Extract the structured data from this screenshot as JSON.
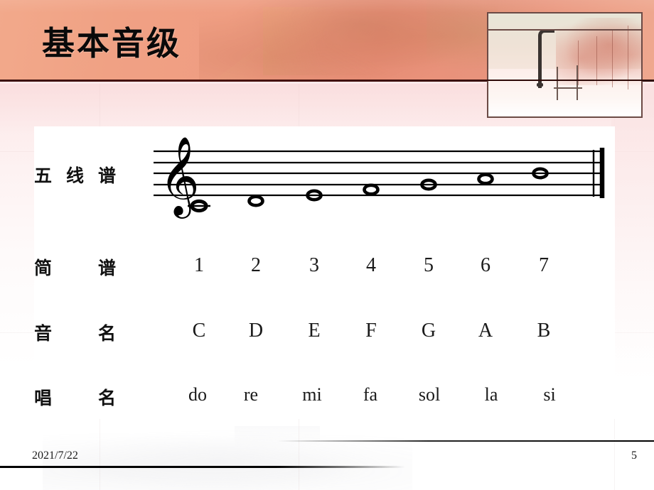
{
  "slide": {
    "title": "基本音级",
    "page_number": "5",
    "date": "2021/7/22"
  },
  "theme": {
    "header_start": "#f2a98b",
    "header_end": "#e8937c",
    "header_rule": "#3b0f0c",
    "panel_bg": "#ffffff",
    "text": "#111111",
    "frame_border": "#6b4a45"
  },
  "table": {
    "rows": [
      {
        "label": "五线谱",
        "name": "staff-notation",
        "kind": "staff"
      },
      {
        "label": "简　谱",
        "name": "numbered-notation",
        "kind": "text",
        "cells": [
          "1",
          "2",
          "3",
          "4",
          "5",
          "6",
          "7"
        ]
      },
      {
        "label": "音　名",
        "name": "pitch-names",
        "kind": "text",
        "cells": [
          "C",
          "D",
          "E",
          "F",
          "G",
          "A",
          "B"
        ]
      },
      {
        "label": "唱　名",
        "name": "solfege-names",
        "kind": "text",
        "cells": [
          "do",
          "re",
          "mi",
          "fa",
          "sol",
          "la",
          "si"
        ]
      }
    ]
  },
  "chart_data": {
    "type": "table",
    "title": "基本音级",
    "categories": [
      "1",
      "2",
      "3",
      "4",
      "5",
      "6",
      "7"
    ],
    "series": [
      {
        "name": "简谱",
        "values": [
          "1",
          "2",
          "3",
          "4",
          "5",
          "6",
          "7"
        ]
      },
      {
        "name": "音名",
        "values": [
          "C",
          "D",
          "E",
          "F",
          "G",
          "A",
          "B"
        ]
      },
      {
        "name": "唱名",
        "values": [
          "do",
          "re",
          "mi",
          "fa",
          "sol",
          "la",
          "si"
        ]
      }
    ]
  },
  "staff": {
    "clef": "treble-clef",
    "line_count": 5,
    "barline": "final-double-barline",
    "notes": [
      {
        "pitch": "C",
        "step": 0,
        "ledger": true
      },
      {
        "pitch": "D",
        "step": 1,
        "ledger": false
      },
      {
        "pitch": "E",
        "step": 2,
        "ledger": false
      },
      {
        "pitch": "F",
        "step": 3,
        "ledger": false
      },
      {
        "pitch": "G",
        "step": 4,
        "ledger": false
      },
      {
        "pitch": "A",
        "step": 5,
        "ledger": false
      },
      {
        "pitch": "B",
        "step": 6,
        "ledger": false
      }
    ]
  }
}
